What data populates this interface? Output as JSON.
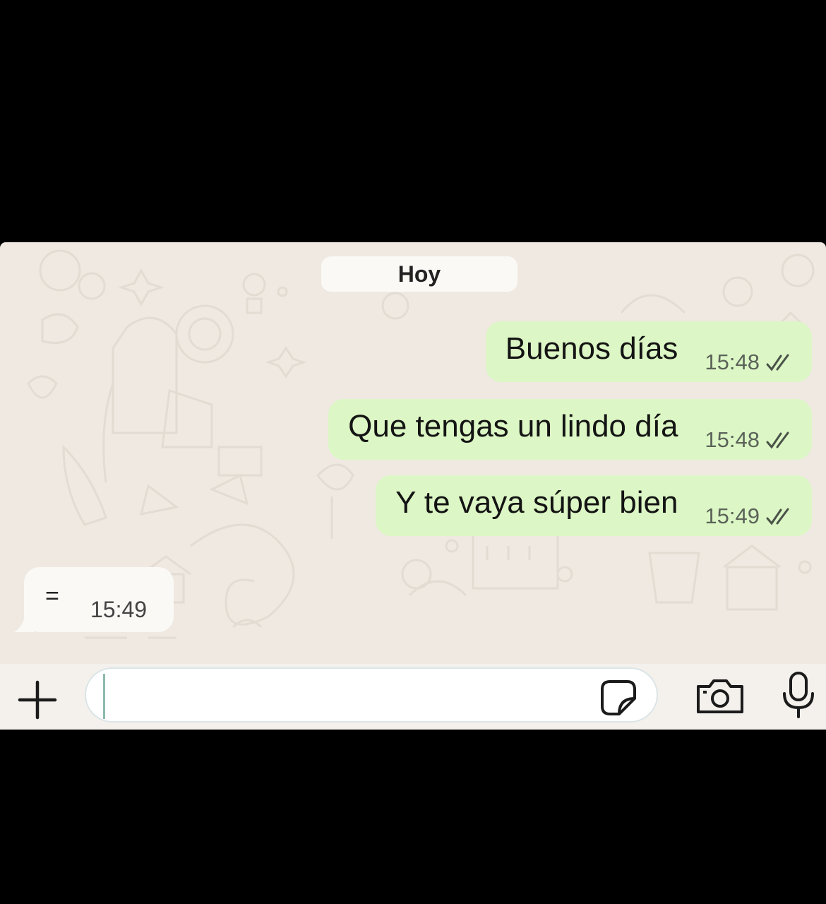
{
  "chat": {
    "date_label": "Hoy",
    "outgoing": [
      {
        "text": "Buenos días",
        "time": "15:48",
        "status_icon": "double-check-icon"
      },
      {
        "text": "Que tengas un lindo día",
        "time": "15:48",
        "status_icon": "double-check-icon"
      },
      {
        "text": "Y te vaya súper bien",
        "time": "15:49",
        "status_icon": "double-check-icon"
      }
    ],
    "incoming": [
      {
        "text": "=",
        "time": "15:49"
      }
    ]
  },
  "composer": {
    "input_value": "",
    "placeholder": "",
    "icons": [
      "plus-icon",
      "sticker-icon",
      "camera-icon",
      "microphone-icon"
    ]
  },
  "colors": {
    "outgoing_bubble": "#dcf7c5",
    "incoming_bubble": "#fbf9f6",
    "chat_background": "#efe9e1",
    "backdrop": "#000000"
  }
}
